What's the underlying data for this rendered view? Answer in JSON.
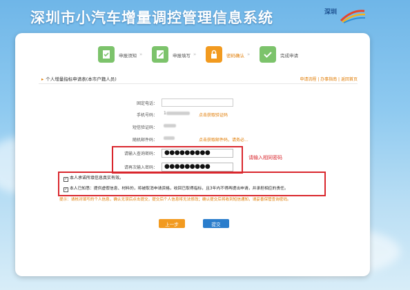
{
  "header": {
    "site_title": "深圳市小汽车增量调控管理信息系统",
    "logo_text": "深圳"
  },
  "steps": [
    {
      "label": "申报须知",
      "icon": "document-check-icon",
      "state": "done"
    },
    {
      "label": "申报填写",
      "icon": "form-edit-icon",
      "state": "done"
    },
    {
      "label": "密码确认",
      "icon": "lock-icon",
      "state": "active"
    },
    {
      "label": "完成申请",
      "icon": "checkmark-icon",
      "state": "pending"
    }
  ],
  "section": {
    "title": "个人增量指标申请表(本市户籍人员)",
    "links": "申请流程 | 办事指南 | 返回首页"
  },
  "form": {
    "fixed_phone_label": "固定电话：",
    "fixed_phone_value": "",
    "mobile_label": "手机号码：",
    "mobile_value": "1",
    "mobile_note": "点击获取验证码",
    "code_label": "短信验证码：",
    "code_value": "",
    "email_label": "随机邮件码：",
    "email_value": "",
    "email_note": "点击获取邮件码，请务必...",
    "password_label": "请输入查询密码：",
    "password_value": "●●●●●●●●●",
    "confirm_label": "请再次输入密码：",
    "confirm_value": "●●●●●●●●●"
  },
  "callout_text": "请输入相同密码",
  "checkbox_1": "本人承诺所填信息真实有效。",
  "checkbox_2": "本人已知悉：提供虚假信息、材料的，将被取消申请资格，收回已取得指标，且3年内不得再提出申请，并承担相应的责任。",
  "warning_text": "提示：请核对填写的个人信息，确认无误后点击提交，提交后个人信息将无法修改；确认提交后将收到短信通知，请妥善保管查询密码。",
  "buttons": {
    "prev": "上一步",
    "submit": "提交"
  },
  "colors": {
    "accent": "#e07a00",
    "highlight": "#d9262c",
    "primary": "#2a7dcc"
  }
}
